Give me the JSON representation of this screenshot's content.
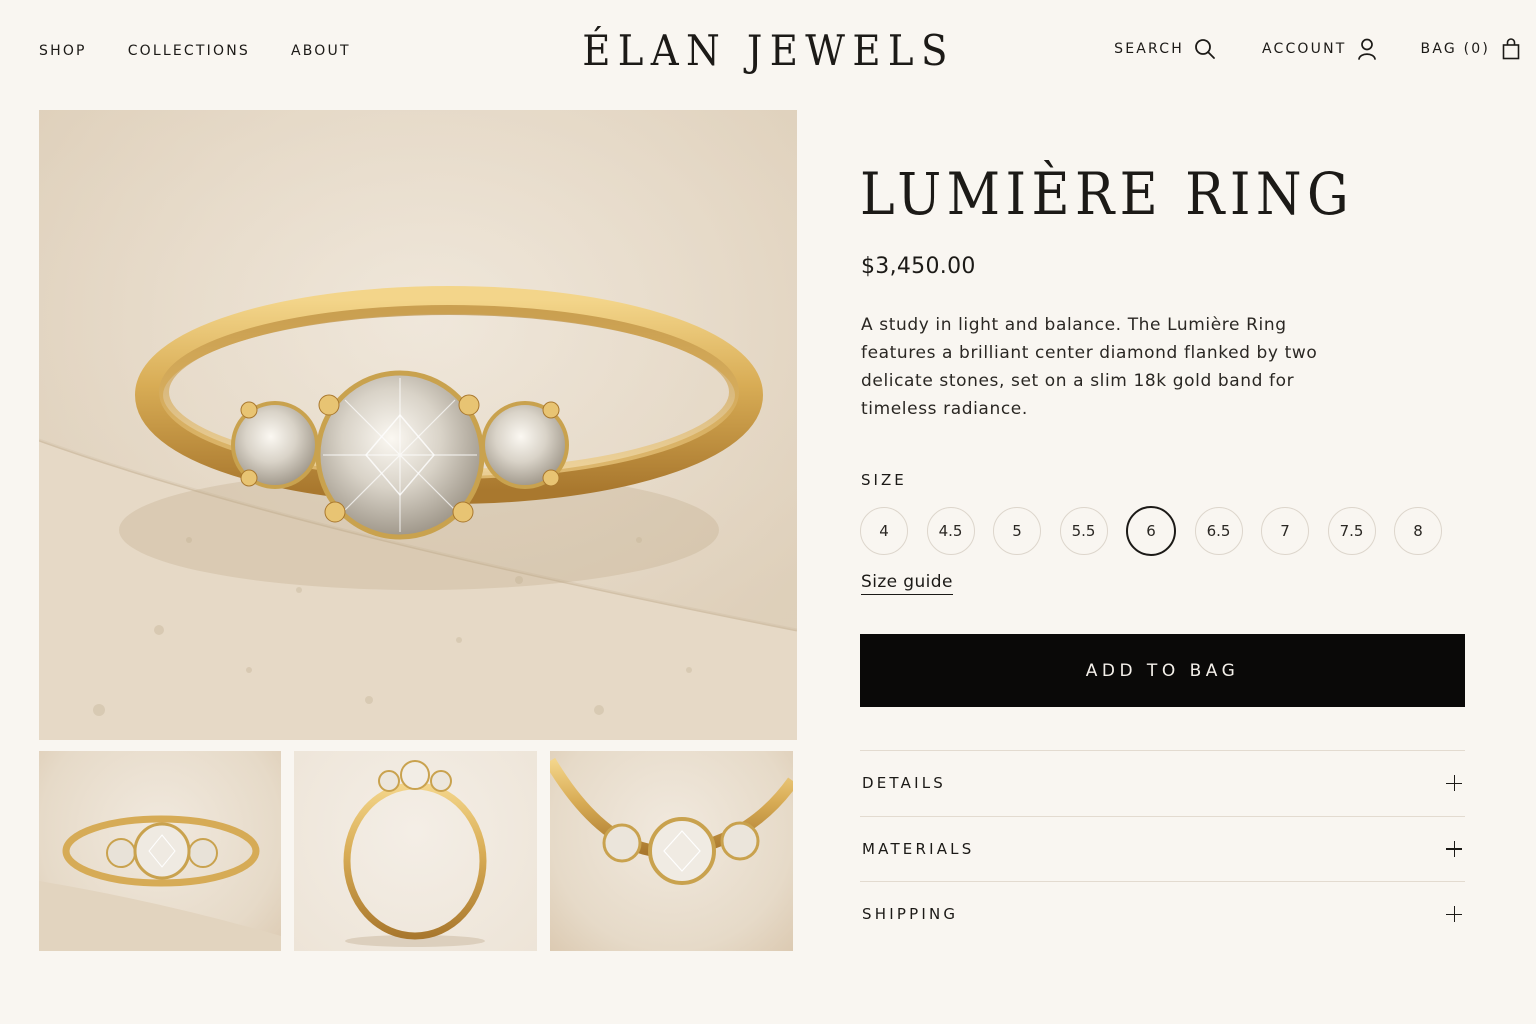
{
  "header": {
    "nav": [
      {
        "label": "SHOP"
      },
      {
        "label": "COLLECTIONS"
      },
      {
        "label": "ABOUT"
      }
    ],
    "brand": "ÉLAN JEWELS",
    "utilities": {
      "search_label": "SEARCH",
      "search_icon": "search-icon",
      "account_label": "ACCOUNT",
      "account_icon": "user-icon",
      "bag_label": "BAG (0)",
      "bag_icon": "shopping-bag-icon"
    }
  },
  "gallery": {
    "main_image": "gold three-stone diamond ring on stone surface",
    "thumbnails": [
      "ring top view on stone",
      "ring side profile",
      "ring close-up of stones"
    ]
  },
  "product": {
    "title": "LUMIÈRE RING",
    "price": "$3,450.00",
    "description": "A study in light and balance. The Lumière Ring features a brilliant center diamond flanked by two delicate stones, set on a slim 18k gold band for timeless radiance.",
    "size_label": "SIZE",
    "sizes": [
      "4",
      "4.5",
      "5",
      "5.5",
      "6",
      "6.5",
      "7",
      "7.5",
      "8"
    ],
    "selected_size": "6",
    "size_guide_label": "Size guide",
    "add_to_bag_label": "ADD TO BAG",
    "accordion": [
      {
        "title": "DETAILS"
      },
      {
        "title": "MATERIALS"
      },
      {
        "title": "SHIPPING"
      }
    ]
  },
  "colors": {
    "background": "#f9f6f1",
    "text": "#1c1a17",
    "button": "#0a0908",
    "gold": "#c9a24e"
  }
}
